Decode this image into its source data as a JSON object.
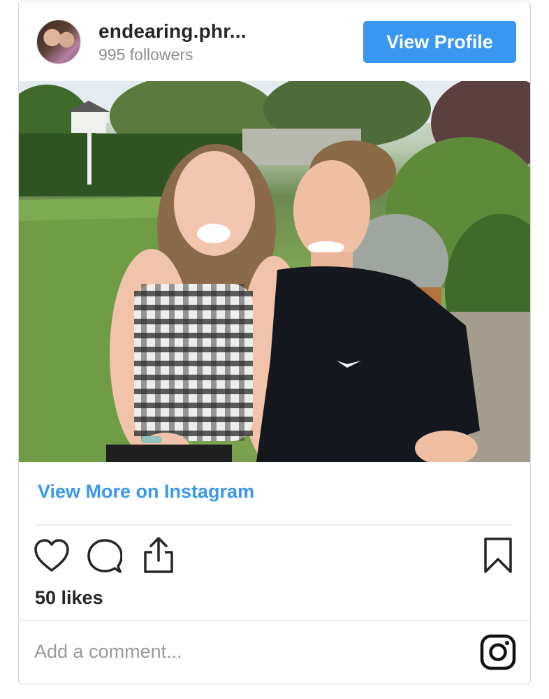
{
  "header": {
    "username": "endearing.phr...",
    "followers": "995 followers",
    "profile_button": "View Profile"
  },
  "post": {
    "view_more_link": "View More on Instagram",
    "likes": "50 likes",
    "comment_placeholder": "Add a comment..."
  },
  "icons": {
    "like": "heart-icon",
    "comment": "comment-bubble-icon",
    "share": "share-upload-icon",
    "save": "bookmark-icon",
    "brand": "instagram-logo-icon"
  },
  "colors": {
    "accent": "#3897f0",
    "text": "#262626",
    "muted": "#8e8e8e"
  }
}
